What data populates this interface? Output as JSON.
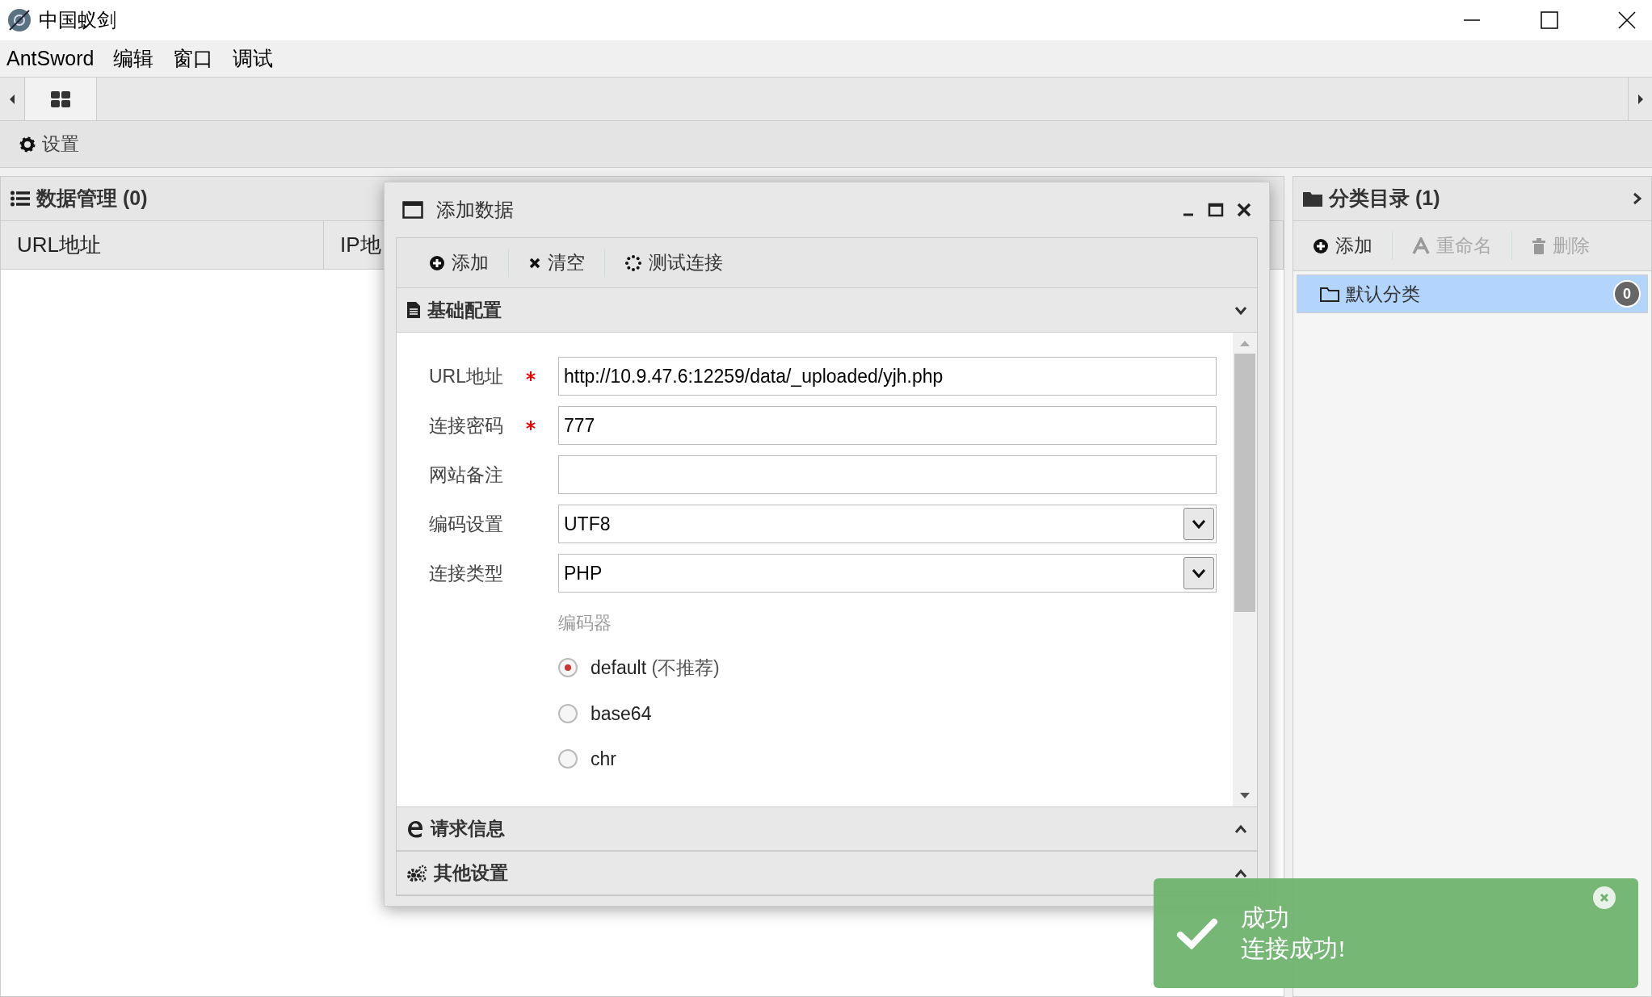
{
  "window": {
    "title": "中国蚁剑"
  },
  "menu": [
    "AntSword",
    "编辑",
    "窗口",
    "调试"
  ],
  "tabs": [
    {
      "selected": true
    }
  ],
  "toolbar": {
    "settings": "设置"
  },
  "data_panel": {
    "title": "数据管理 (0)",
    "columns": [
      "URL地址",
      "IP地"
    ]
  },
  "category_panel": {
    "title": "分类目录 (1)",
    "actions": [
      {
        "kind": "add",
        "label": "添加",
        "disabled": false
      },
      {
        "kind": "rename",
        "label": "重命名",
        "disabled": true
      },
      {
        "kind": "delete",
        "label": "删除",
        "disabled": true
      }
    ],
    "items": [
      {
        "label": "默认分类",
        "count": "0",
        "selected": true
      }
    ]
  },
  "dialog": {
    "title": "添加数据",
    "actions": [
      {
        "kind": "add",
        "label": "添加"
      },
      {
        "kind": "clear",
        "label": "清空"
      },
      {
        "kind": "test",
        "label": "测试连接"
      }
    ],
    "sections": [
      {
        "kind": "doc",
        "title": "基础配置",
        "expanded": true
      },
      {
        "kind": "edge",
        "title": "请求信息",
        "expanded": false
      },
      {
        "kind": "gears",
        "title": "其他设置",
        "expanded": false
      }
    ],
    "fields": [
      {
        "kind": "text",
        "label": "URL地址",
        "required": true,
        "value": "http://10.9.47.6:12259/data/_uploaded/yjh.php"
      },
      {
        "kind": "text",
        "label": "连接密码",
        "required": true,
        "value": "777"
      },
      {
        "kind": "text",
        "label": "网站备注",
        "required": false
      },
      {
        "kind": "select",
        "label": "编码设置",
        "required": false,
        "value": "UTF8"
      },
      {
        "kind": "select",
        "label": "连接类型",
        "required": false,
        "value": "PHP"
      }
    ],
    "encoder": {
      "label": "编码器",
      "options": [
        {
          "label": "default",
          "note": "(不推荐)",
          "selected": true
        },
        {
          "label": "base64",
          "selected": false
        },
        {
          "label": "chr",
          "selected": false
        }
      ]
    }
  },
  "toast": {
    "title": "成功",
    "message": "连接成功!"
  }
}
